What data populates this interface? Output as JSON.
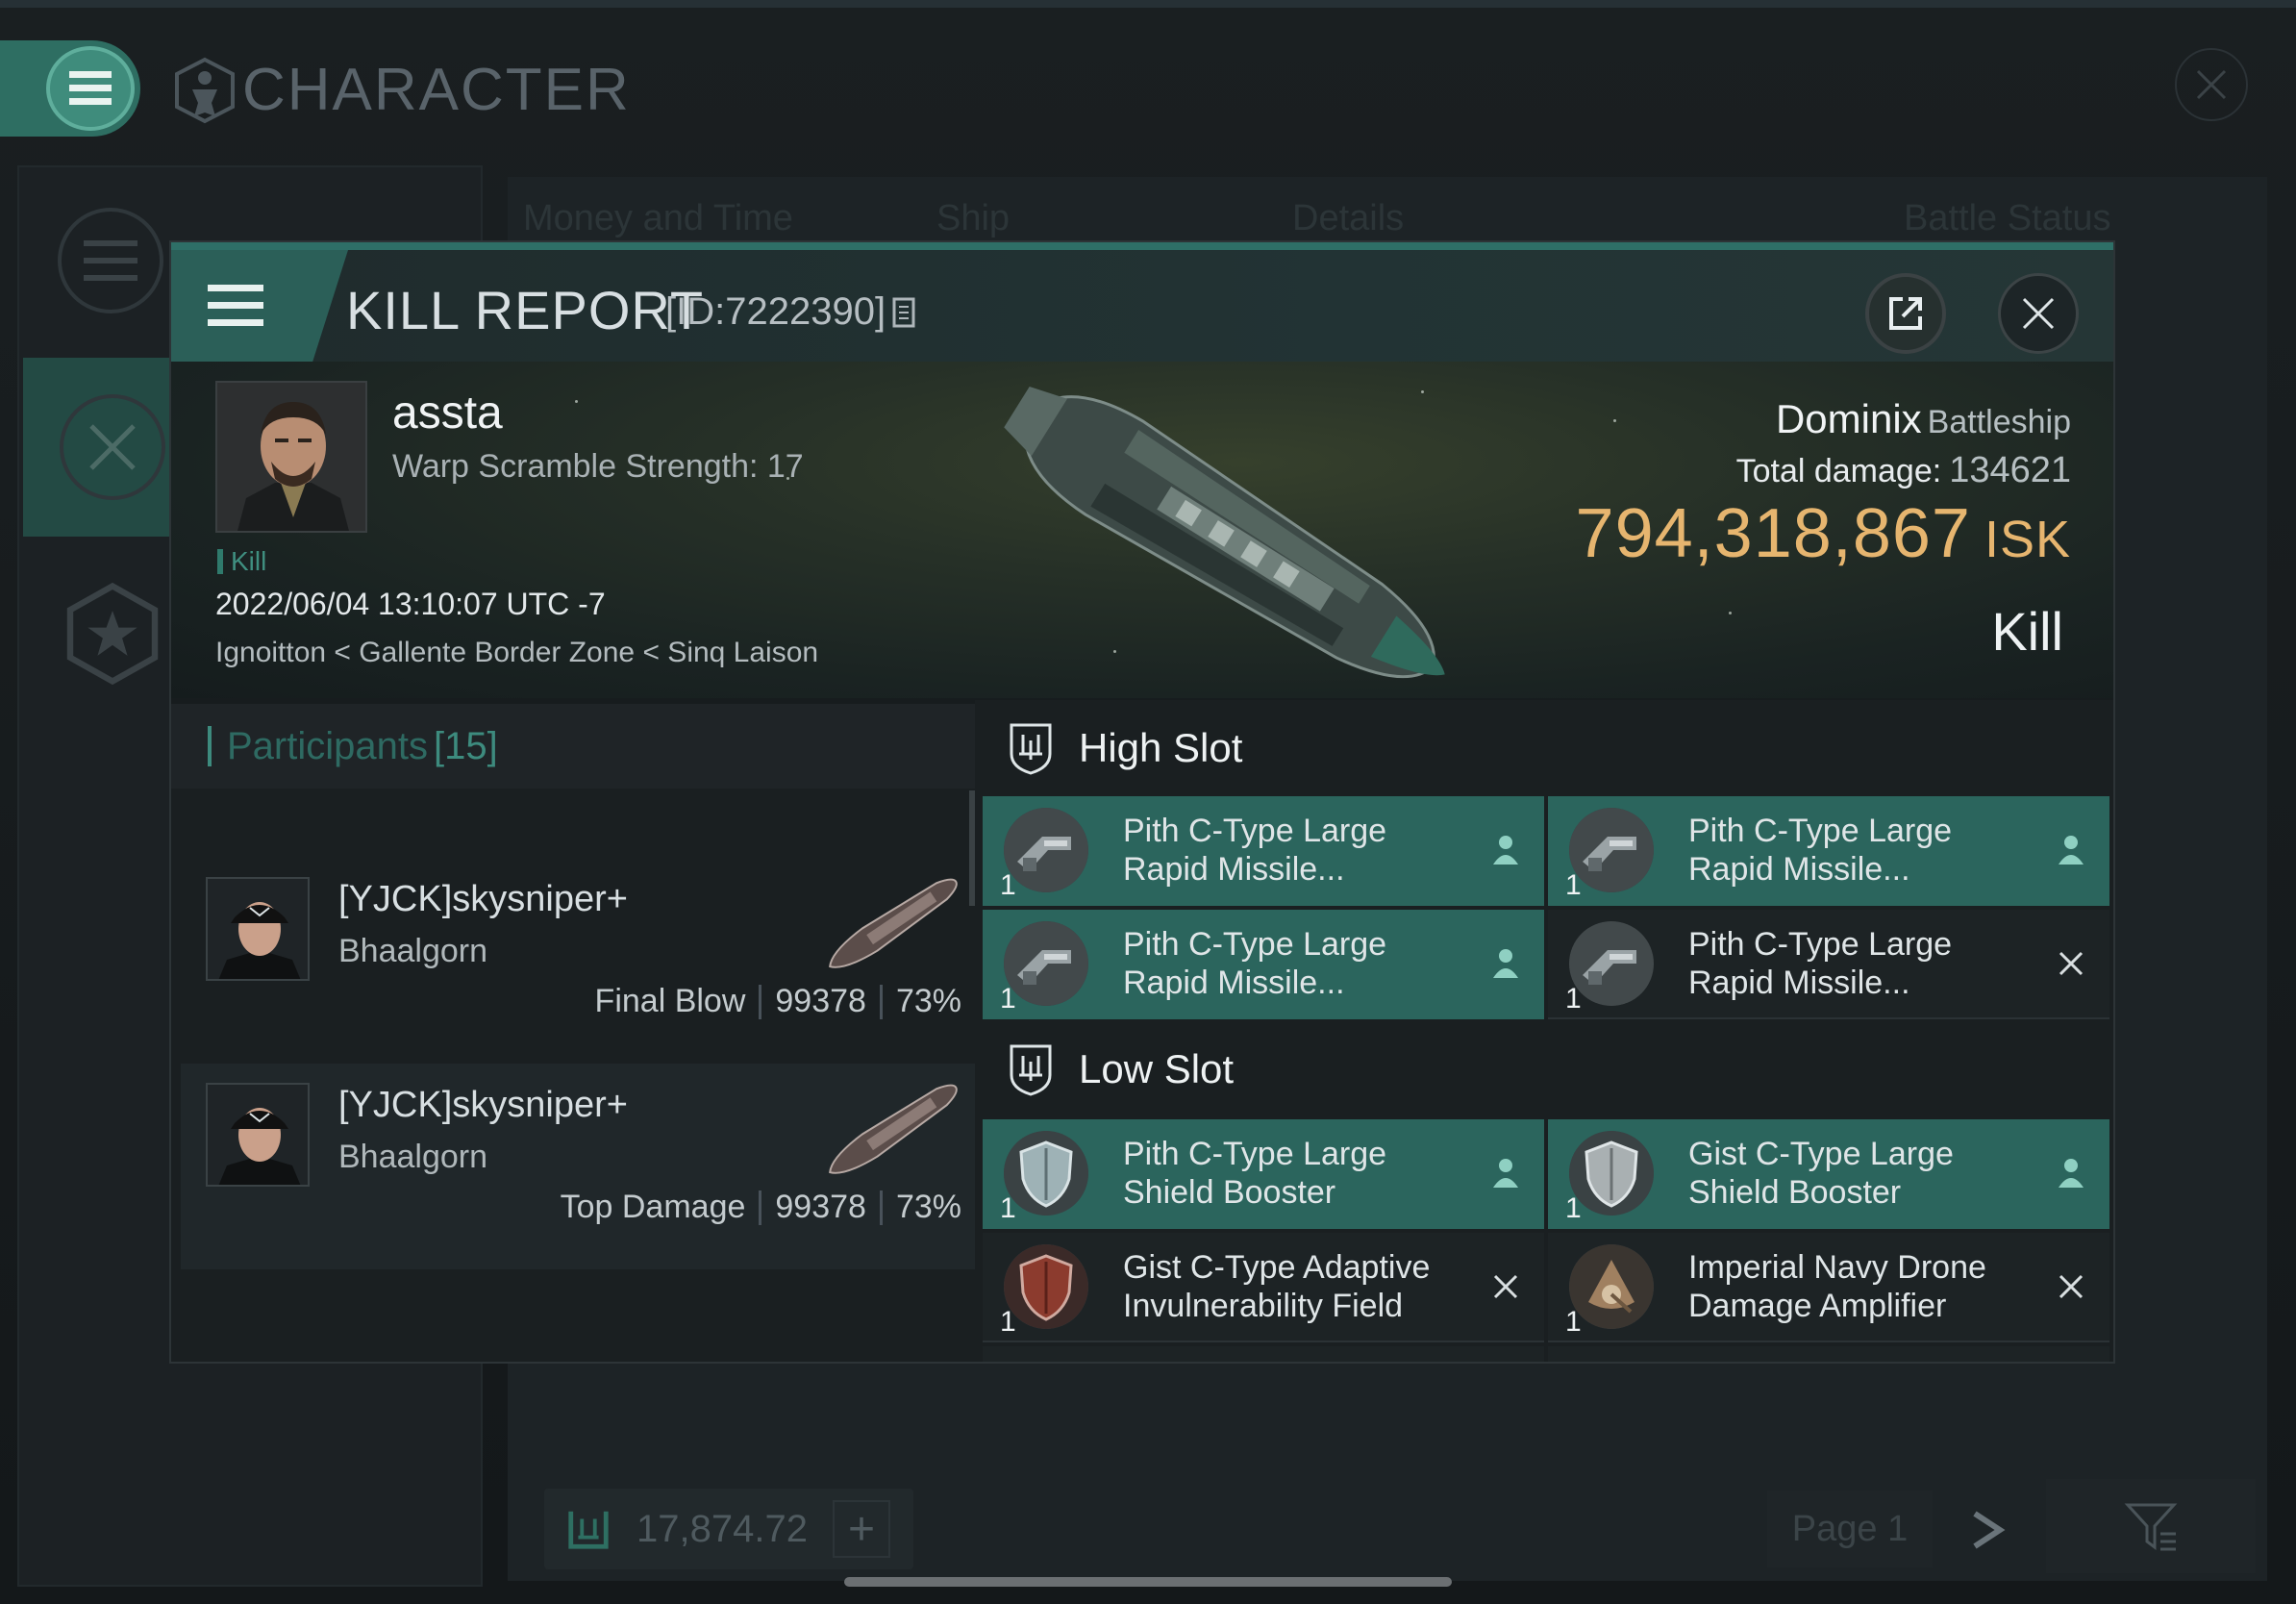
{
  "app": {
    "title": "CHARACTER",
    "background_tabs": [
      "Money and Time",
      "Ship",
      "Details",
      "Battle Status"
    ],
    "bottom_bar": {
      "value": "17,874.72",
      "page_label": "Page 1"
    }
  },
  "kill_report": {
    "title": "KILL REPORT",
    "id_label": "[ID:7222390]",
    "victim": {
      "name": "assta",
      "warp_scramble": "Warp Scramble Strength: 17",
      "tag": "Kill",
      "datetime": "2022/06/04 13:10:07 UTC -7",
      "location": "Ignoitton < Gallente Border Zone < Sinq Laison"
    },
    "ship": {
      "name": "Dominix",
      "class": "Battleship",
      "total_damage_label": "Total damage:",
      "total_damage": "134621",
      "isk_value": "794,318,867",
      "isk_unit": "ISK",
      "result": "Kill"
    },
    "participants": {
      "label": "Participants",
      "count": "[15]",
      "rows": [
        {
          "name": "[YJCK]skysniper+",
          "ship": "Bhaalgorn",
          "role": "Final Blow",
          "damage": "99378",
          "percent": "73%"
        },
        {
          "name": "[YJCK]skysniper+",
          "ship": "Bhaalgorn",
          "role": "Top Damage",
          "damage": "99378",
          "percent": "73%"
        }
      ]
    },
    "high_slot": {
      "label": "High Slot",
      "modules": [
        {
          "line1": "Pith C-Type Large",
          "line2": "Rapid Missile...",
          "qty": "1",
          "status": "fitted",
          "icon": "missile-launcher-icon"
        },
        {
          "line1": "Pith C-Type Large",
          "line2": "Rapid Missile...",
          "qty": "1",
          "status": "fitted",
          "icon": "missile-launcher-icon"
        },
        {
          "line1": "Pith C-Type Large",
          "line2": "Rapid Missile...",
          "qty": "1",
          "status": "fitted",
          "icon": "missile-launcher-icon"
        },
        {
          "line1": "Pith C-Type Large",
          "line2": "Rapid Missile...",
          "qty": "1",
          "status": "destroyed",
          "icon": "missile-launcher-icon"
        }
      ]
    },
    "low_slot": {
      "label": "Low Slot",
      "modules": [
        {
          "line1": "Pith C-Type Large",
          "line2": "Shield Booster",
          "qty": "1",
          "status": "fitted",
          "icon": "shield-booster-icon"
        },
        {
          "line1": "Gist C-Type Large",
          "line2": "Shield Booster",
          "qty": "1",
          "status": "fitted",
          "icon": "shield-booster-icon"
        },
        {
          "line1": "Gist C-Type Adaptive",
          "line2": "Invulnerability Field",
          "qty": "1",
          "status": "destroyed",
          "icon": "invulnerability-field-icon"
        },
        {
          "line1": "Imperial Navy Drone",
          "line2": "Damage Amplifier",
          "qty": "1",
          "status": "destroyed",
          "icon": "drone-damage-amplifier-icon"
        }
      ]
    }
  }
}
